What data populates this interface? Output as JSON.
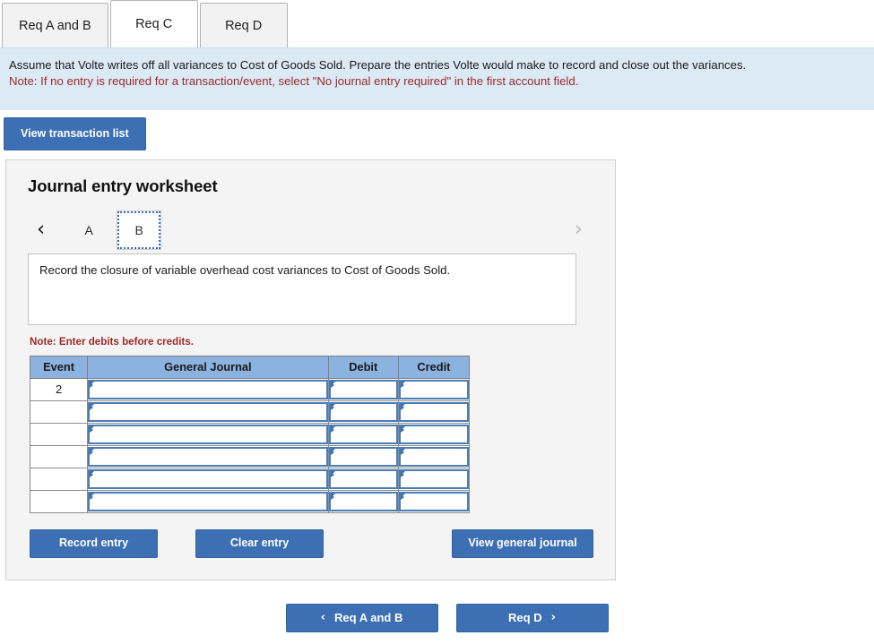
{
  "tabs": [
    {
      "label": "Req A and B",
      "active": false
    },
    {
      "label": "Req C",
      "active": true
    },
    {
      "label": "Req D",
      "active": false
    }
  ],
  "instructions": {
    "body": "Assume that Volte writes off all variances to Cost of Goods Sold. Prepare the entries Volte would make to record and close out the variances.",
    "note": "Note: If no entry is required for a transaction/event, select \"No journal entry required\" in the first account field."
  },
  "toolbar": {
    "view_transaction_list": "View transaction list"
  },
  "worksheet": {
    "title": "Journal entry worksheet",
    "pager": {
      "prev_icon": "‹",
      "next_icon": "›",
      "pages": [
        {
          "label": "A",
          "selected": false
        },
        {
          "label": "B",
          "selected": true
        }
      ]
    },
    "description": "Record the closure of variable overhead cost variances to Cost of Goods Sold.",
    "enter_note": "Note: Enter debits before credits.",
    "table": {
      "headers": [
        "Event",
        "General Journal",
        "Debit",
        "Credit"
      ],
      "rows": [
        {
          "event": "2",
          "general_journal": "",
          "debit": "",
          "credit": ""
        },
        {
          "event": "",
          "general_journal": "",
          "debit": "",
          "credit": ""
        },
        {
          "event": "",
          "general_journal": "",
          "debit": "",
          "credit": ""
        },
        {
          "event": "",
          "general_journal": "",
          "debit": "",
          "credit": ""
        },
        {
          "event": "",
          "general_journal": "",
          "debit": "",
          "credit": ""
        },
        {
          "event": "",
          "general_journal": "",
          "debit": "",
          "credit": ""
        }
      ]
    },
    "actions": {
      "record_entry": "Record entry",
      "clear_entry": "Clear entry",
      "view_general_journal": "View general journal"
    }
  },
  "footer_nav": {
    "prev": {
      "label": "Req A and B",
      "icon": "‹"
    },
    "next": {
      "label": "Req D",
      "icon": "›"
    }
  },
  "colors": {
    "accent_blue": "#3d6fb4",
    "banner_blue": "#dbeaf5",
    "table_header_blue": "#8cb3e0",
    "note_red": "#9c2a2a",
    "panel_gray": "#f4f4f4"
  }
}
